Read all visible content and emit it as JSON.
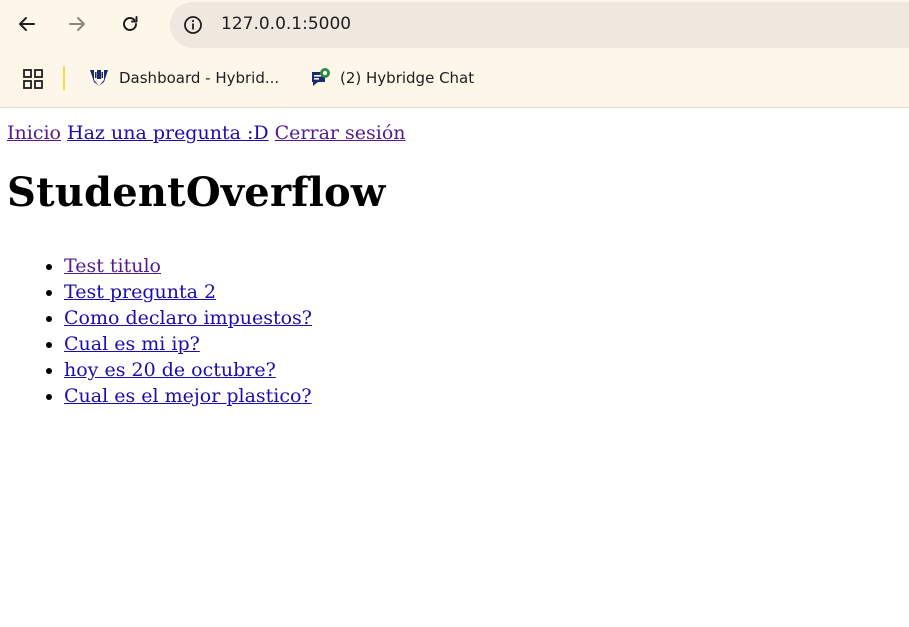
{
  "browser": {
    "url": "127.0.0.1:5000",
    "bookmarks": [
      {
        "label": "Dashboard - Hybrid...",
        "icon": "hybridge-logo-icon"
      },
      {
        "label": "(2) Hybridge Chat",
        "icon": "chat-bubble-icon"
      }
    ]
  },
  "page": {
    "nav": [
      {
        "label": "Inicio"
      },
      {
        "label": "Haz una pregunta :D"
      },
      {
        "label": "Cerrar sesión"
      }
    ],
    "title": "StudentOverflow",
    "questions": [
      {
        "label": "Test titulo"
      },
      {
        "label": "Test pregunta 2"
      },
      {
        "label": "Como declaro impuestos?"
      },
      {
        "label": "Cual es mi ip?"
      },
      {
        "label": "hoy es 20 de octubre?"
      },
      {
        "label": "Cual es el mejor plastico?"
      }
    ]
  },
  "colors": {
    "chrome_bg": "#fdf7ea",
    "omnibox_bg": "#efe8df",
    "link": "#1a0dab",
    "link_visited": "#551a8b"
  }
}
